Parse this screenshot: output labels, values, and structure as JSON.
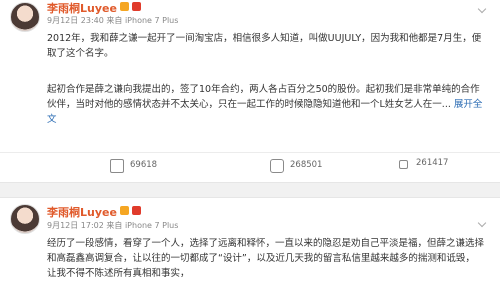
{
  "post1": {
    "username": "李雨桐Luyee",
    "meta": "9月12日 23:40 来自 iPhone 7 Plus",
    "paragraph1": "2012年，我和薛之谦一起开了一间淘宝店，相信很多人知道，叫做UUJULY，因为我和他都是7月生，便取了这个名字。",
    "paragraph2": "起初合作是薛之谦向我提出的，签了10年合约，两人各占百分之50的股份。起初我们是非常单纯的合作伙伴，当时对他的感情状态并不太关心，只在一起工作的时候隐隐知道他和一个L姓女艺人在一",
    "ellipsis": "... ",
    "expand_label": "展开全文",
    "reposts": "69618",
    "comments": "268501",
    "likes": "261417"
  },
  "post2": {
    "username": "李雨桐Luyee",
    "meta": "9月12日 17:02 来自 iPhone 7 Plus",
    "paragraph1": "经历了一段感情，看穿了一个人，选择了远离和释怀，一直以来的隐忍是劝自己平淡是福，但薛之谦选择和高磊鑫高调复合，让以往的一切都成了“设计”，以及近几天我的留言私信里越来越多的揣测和诋毁，让我不得不陈述所有真相和事实，"
  },
  "icons": [
    "avatar",
    "vip-badge",
    "repost-icon",
    "comment-icon",
    "like-icon",
    "chevron-down-icon"
  ]
}
